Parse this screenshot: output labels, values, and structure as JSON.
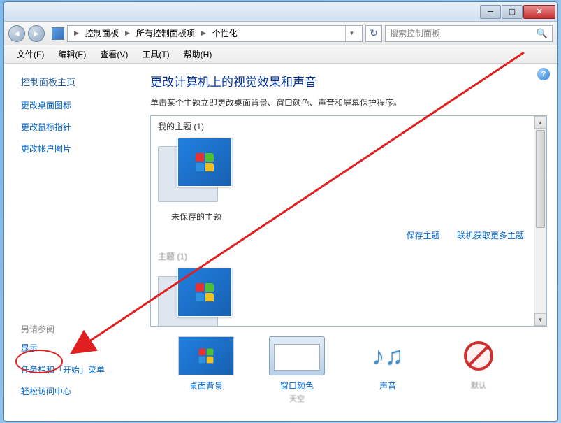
{
  "titlebar": {
    "min": "─",
    "max": "▢",
    "close": "✕"
  },
  "nav": {
    "back": "◄",
    "fwd": "►",
    "refresh": "↻"
  },
  "breadcrumb": {
    "items": [
      "控制面板",
      "所有控制面板项",
      "个性化"
    ]
  },
  "search": {
    "placeholder": "搜索控制面板"
  },
  "menu": {
    "file": "文件(F)",
    "edit": "编辑(E)",
    "view": "查看(V)",
    "tools": "工具(T)",
    "help": "帮助(H)"
  },
  "sidebar": {
    "home": "控制面板主页",
    "links": [
      "更改桌面图标",
      "更改鼠标指针",
      "更改帐户图片"
    ],
    "see_also": "另请参阅",
    "bottom_links": [
      "显示",
      "任务栏和「开始」菜单",
      "轻松访问中心"
    ]
  },
  "main": {
    "title": "更改计算机上的视觉效果和声音",
    "desc": "单击某个主题立即更改桌面背景、窗口颜色、声音和屏幕保护程序。",
    "section1": "我的主题 (1)",
    "theme1_label": "未保存的主题",
    "save_theme": "保存主题",
    "get_more": "联机获取更多主题",
    "section2": "主题 (1)"
  },
  "strip": {
    "desktop_bg": {
      "title": "桌面背景",
      "sub": ""
    },
    "window_color": {
      "title": "窗口颜色",
      "sub": "天空"
    },
    "sound": {
      "title": "声音",
      "sub": ""
    },
    "screensaver": {
      "title": "",
      "sub": "默认"
    }
  }
}
